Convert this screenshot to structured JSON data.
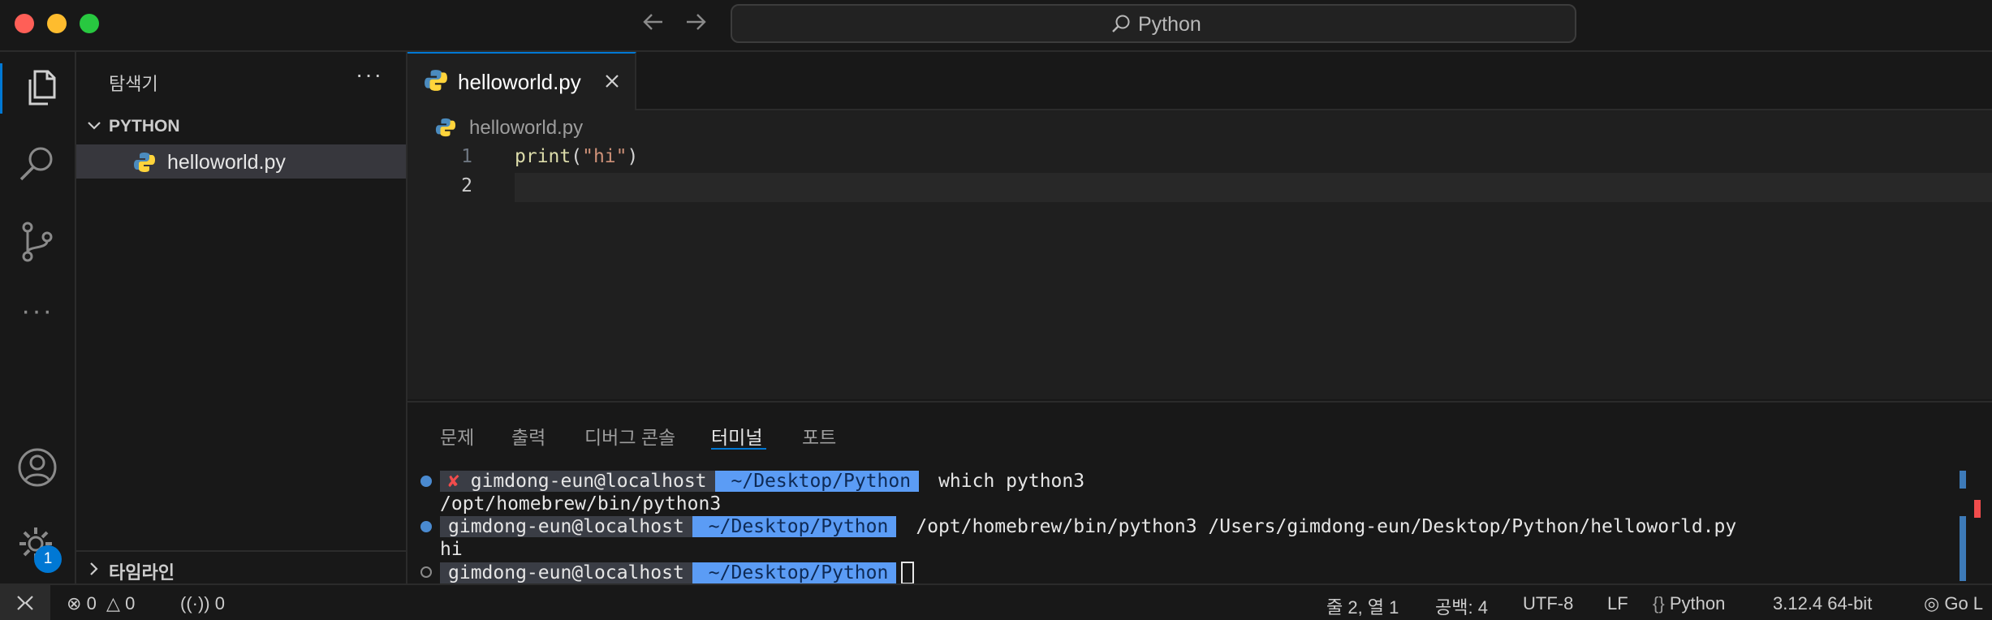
{
  "titlebar": {
    "search_text": "Python"
  },
  "sidebar": {
    "title": "탐색기",
    "more": "···",
    "folder": "PYTHON",
    "file": "helloworld.py",
    "timeline": "타임라인"
  },
  "activity": {
    "badge": "1"
  },
  "editor": {
    "tab_label": "helloworld.py",
    "breadcrumb": "helloworld.py",
    "lines": [
      "1",
      "2"
    ],
    "code": {
      "fn": "print",
      "open": "(",
      "str": "\"hi\"",
      "close": ")"
    }
  },
  "panel": {
    "tabs": [
      "문제",
      "출력",
      "디버그 콘솔",
      "터미널",
      "포트"
    ],
    "terminal": {
      "user": "gimdong-eun@localhost",
      "error_mark": "✘",
      "path": "~/Desktop/Python",
      "cmd1": "which python3",
      "out1": "/opt/homebrew/bin/python3",
      "cmd2": "/opt/homebrew/bin/python3 /Users/gimdong-eun/Desktop/Python/helloworld.py",
      "out2": "hi"
    }
  },
  "statusbar": {
    "errors": "0",
    "warnings": "0",
    "ports": "0",
    "position": "줄 2, 열 1",
    "spaces": "공백: 4",
    "encoding": "UTF-8",
    "eol": "LF",
    "language": "Python",
    "interpreter": "3.12.4 64-bit",
    "golive": "Go L"
  },
  "colors": {
    "accent": "#0078d4",
    "prompt_path": "#5b9cf5",
    "prompt_user": "#3a3d45",
    "error": "#f14c4c"
  }
}
